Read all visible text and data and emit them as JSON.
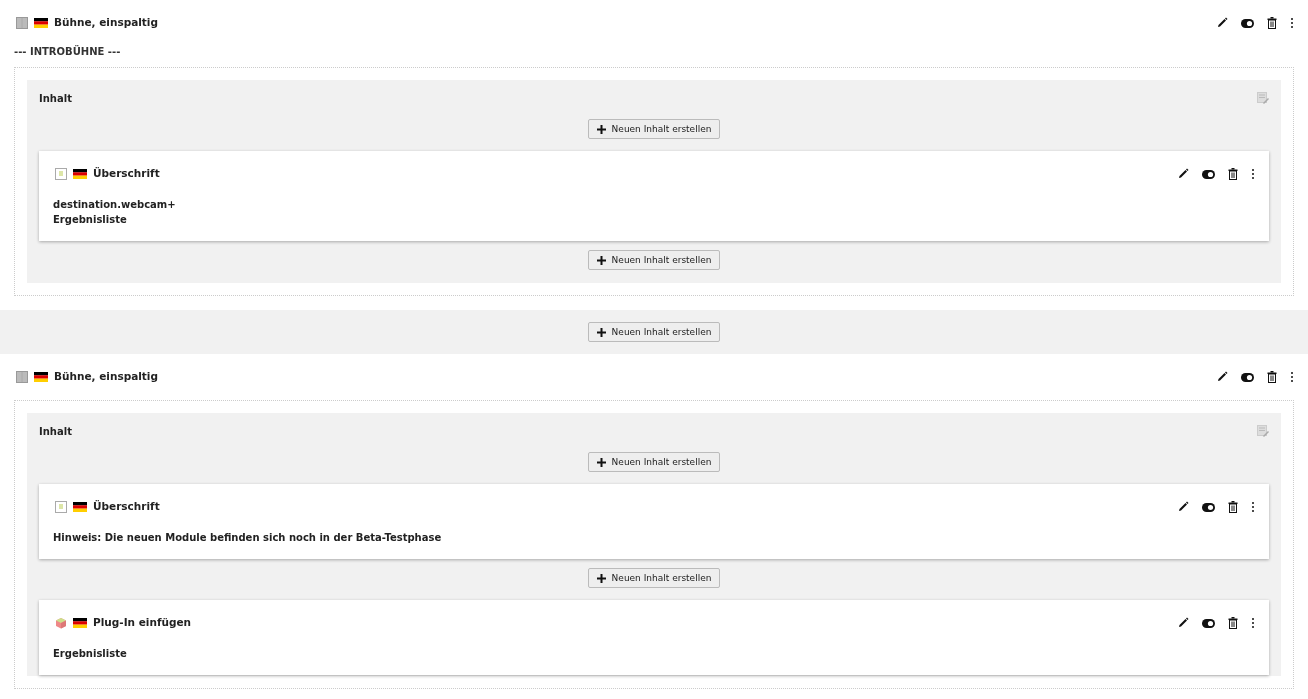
{
  "blocks": [
    {
      "kind": "container",
      "title": "Bühne, einspaltig",
      "subtitle": "--- INTROBÜHNE ---",
      "column": {
        "title": "Inhalt",
        "items": [
          {
            "kind": "button",
            "label": "Neuen Inhalt erstellen"
          },
          {
            "kind": "text-element",
            "title": "Überschrift",
            "lines": [
              "destination.webcam+",
              "Ergebnisliste"
            ]
          },
          {
            "kind": "button",
            "label": "Neuen Inhalt erstellen"
          }
        ]
      }
    },
    {
      "kind": "button",
      "label": "Neuen Inhalt erstellen"
    },
    {
      "kind": "container",
      "title": "Bühne, einspaltig",
      "column": {
        "title": "Inhalt",
        "items": [
          {
            "kind": "button",
            "label": "Neuen Inhalt erstellen"
          },
          {
            "kind": "text-element",
            "title": "Überschrift",
            "lines": [
              "Hinweis: Die neuen Module befinden sich noch in der Beta-Testphase"
            ]
          },
          {
            "kind": "button",
            "label": "Neuen Inhalt erstellen"
          },
          {
            "kind": "plugin-element",
            "title": "Plug-In einfügen",
            "lines": [
              "Ergebnisliste"
            ]
          }
        ]
      }
    }
  ]
}
